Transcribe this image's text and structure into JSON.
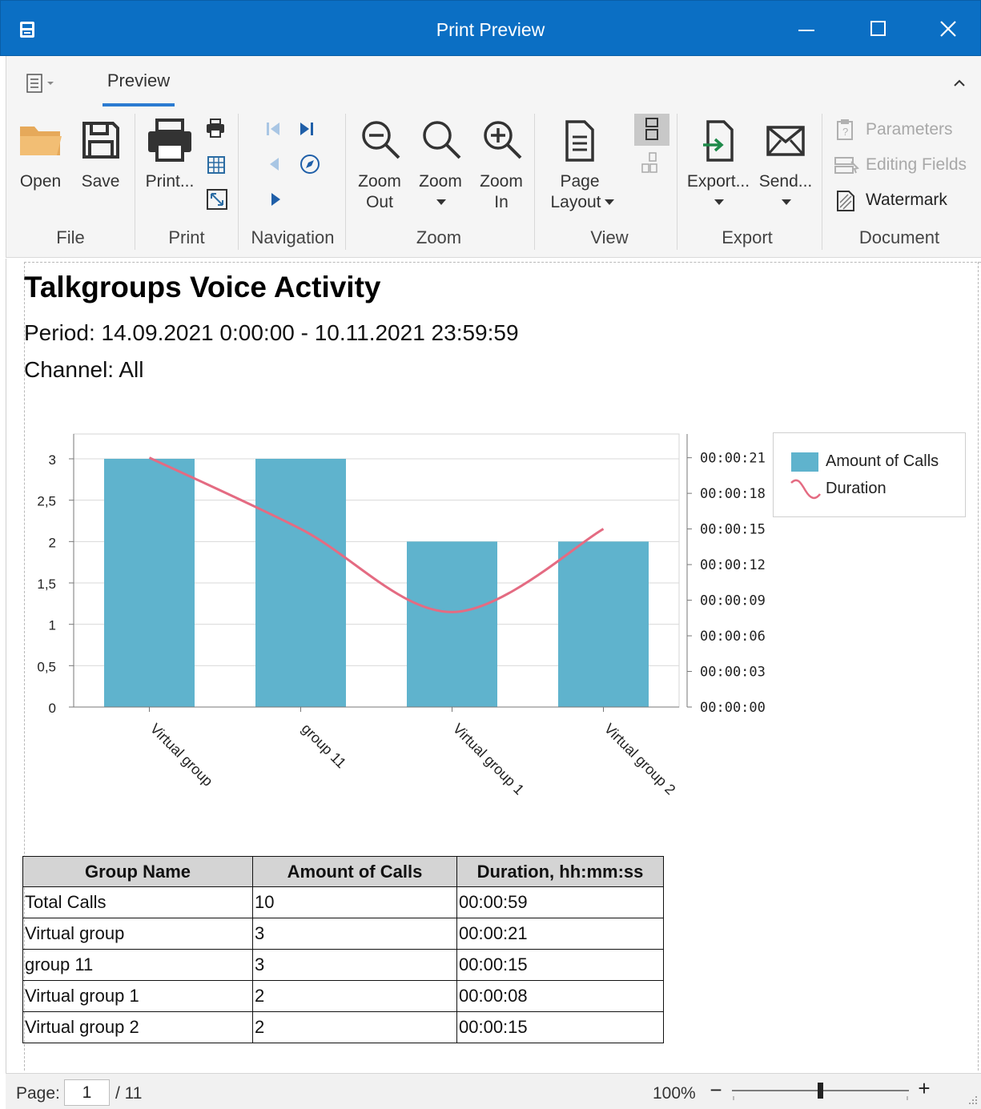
{
  "window": {
    "title": "Print Preview"
  },
  "ribbon": {
    "tab": "Preview",
    "groups": {
      "file": "File",
      "print": "Print",
      "navigation": "Navigation",
      "zoom": "Zoom",
      "view": "View",
      "export": "Export",
      "document": "Document"
    },
    "buttons": {
      "open": "Open",
      "save": "Save",
      "print": "Print...",
      "zoom_out_1": "Zoom",
      "zoom_out_2": "Out",
      "zoom": "Zoom",
      "zoom_in_1": "Zoom",
      "zoom_in_2": "In",
      "page_layout_1": "Page",
      "page_layout_2": "Layout",
      "export": "Export...",
      "send": "Send..."
    },
    "document_items": {
      "parameters": "Parameters",
      "editing_fields": "Editing Fields",
      "watermark": "Watermark"
    }
  },
  "report": {
    "title": "Talkgroups Voice Activity",
    "period": "Period: 14.09.2021 0:00:00 - 10.11.2021 23:59:59",
    "channel": "Channel: All"
  },
  "chart_data": {
    "type": "bar",
    "categories": [
      "Virtual group",
      "group 11",
      "Virtual group 1",
      "Virtual group 2"
    ],
    "series": [
      {
        "name": "Amount of Calls",
        "type": "bar",
        "axis": "left",
        "values": [
          3,
          3,
          2,
          2
        ],
        "color": "#5fb3cd"
      },
      {
        "name": "Duration",
        "type": "line",
        "axis": "right",
        "values_seconds": [
          21,
          15,
          8,
          15
        ],
        "color": "#e46b82"
      }
    ],
    "y_left": {
      "ticks": [
        "0",
        "0,5",
        "1",
        "1,5",
        "2",
        "2,5",
        "3"
      ],
      "ylim": [
        0,
        3.3
      ]
    },
    "y_right": {
      "ticks": [
        "00:00:00",
        "00:00:03",
        "00:00:06",
        "00:00:09",
        "00:00:12",
        "00:00:15",
        "00:00:18",
        "00:00:21"
      ],
      "ylim_seconds": [
        0,
        23
      ]
    },
    "grid": true,
    "legend": "right"
  },
  "table": {
    "headers": [
      "Group Name",
      "Amount of Calls",
      "Duration, hh:mm:ss"
    ],
    "rows": [
      [
        "Total Calls",
        "10",
        "00:00:59"
      ],
      [
        "Virtual group",
        "3",
        "00:00:21"
      ],
      [
        "group 11",
        "3",
        "00:00:15"
      ],
      [
        "Virtual group 1",
        "2",
        "00:00:08"
      ],
      [
        "Virtual group 2",
        "2",
        "00:00:15"
      ]
    ]
  },
  "statusbar": {
    "page_label": "Page:",
    "page_value": "1",
    "page_total": "/ 11",
    "zoom": "100%",
    "minus": "−",
    "plus": "+",
    "zoom_level": 0.5
  },
  "colors": {
    "titlebar": "#0b6fc4",
    "accent": "#2b7bd1",
    "bar": "#5fb3cd",
    "line": "#e46b82"
  }
}
